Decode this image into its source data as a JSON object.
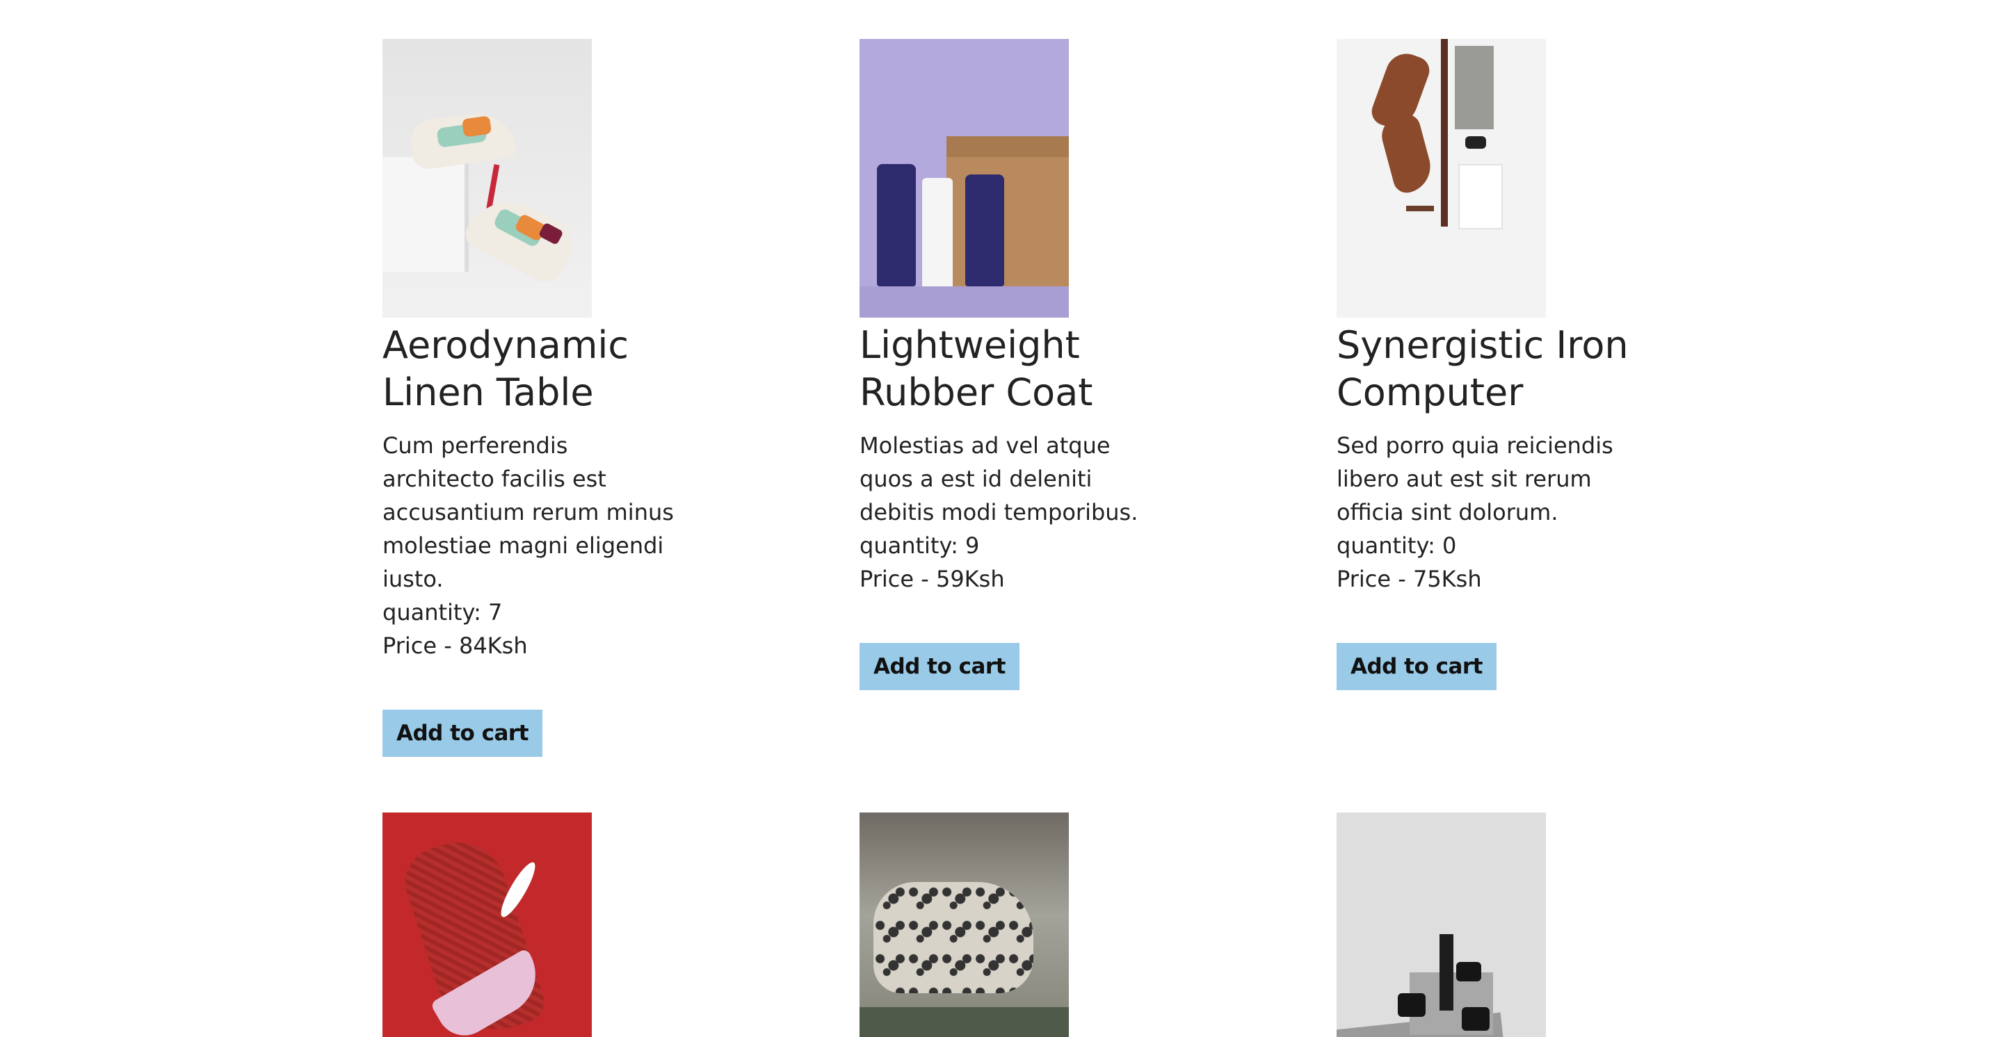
{
  "products": [
    {
      "title": "Aerodynamic Linen Table",
      "description": "Cum perferendis architecto facilis est accusantium rerum minus molestiae magni eligendi iusto.",
      "quantity_text": "quantity: 7",
      "price_text": "Price - 84Ksh",
      "button_label": "Add to cart",
      "image": "sneakers-on-box-photo"
    },
    {
      "title": "Lightweight Rubber Coat",
      "description": "Molestias ad vel atque quos a est id deleniti debitis modi temporibus.",
      "quantity_text": "quantity: 9",
      "price_text": "Price - 59Ksh",
      "button_label": "Add to cart",
      "image": "skincare-tubes-photo"
    },
    {
      "title": "Synergistic Iron Computer",
      "description": "Sed porro quia reiciendis libero aut est sit rerum officia sint dolorum.",
      "quantity_text": "quantity: 0",
      "price_text": "Price - 75Ksh",
      "button_label": "Add to cart",
      "image": "menswear-flatlay-photo"
    },
    {
      "image": "red-running-shoe-photo"
    },
    {
      "image": "snow-leopard-photo"
    },
    {
      "image": "cosmetics-on-stone-photo"
    }
  ],
  "colors": {
    "button_bg": "#99cbe8",
    "text": "#222222",
    "background": "#ffffff"
  }
}
